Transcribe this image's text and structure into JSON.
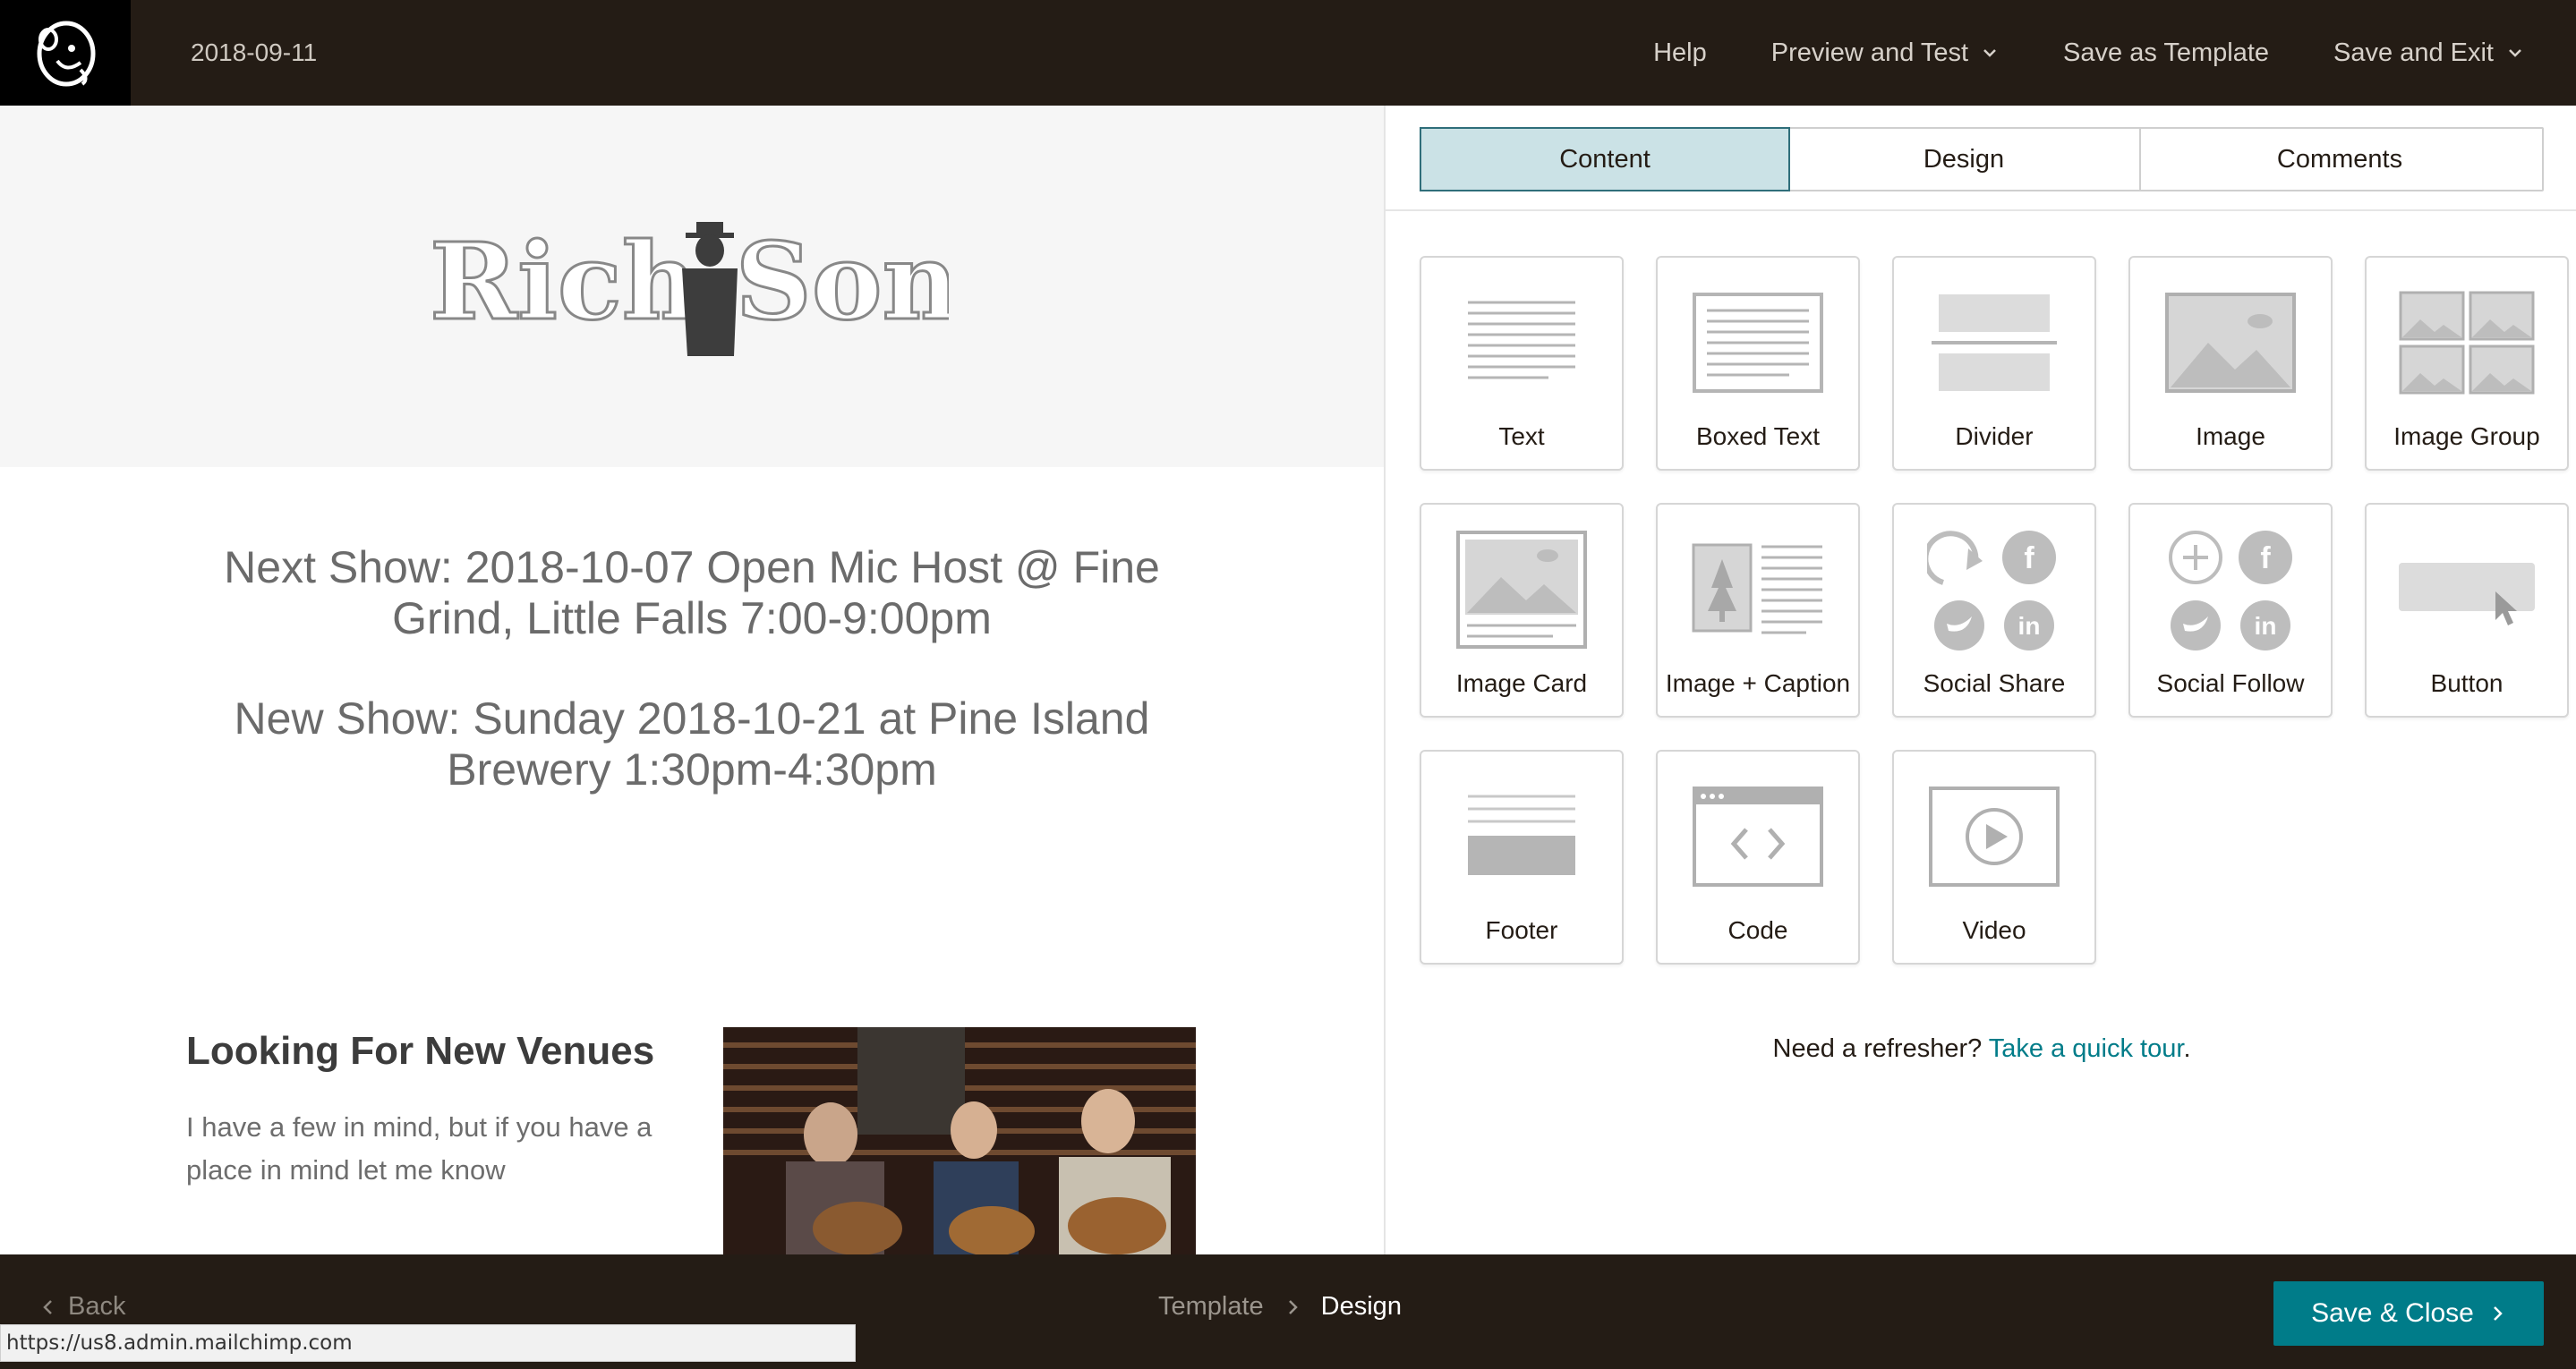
{
  "topbar": {
    "logo_icon": "mailchimp-logo-icon",
    "campaign_name": "2018-09-11",
    "nav": {
      "help": "Help",
      "preview_test": "Preview and Test",
      "save_template": "Save as Template",
      "save_exit": "Save and Exit"
    }
  },
  "preview": {
    "brand_logo_text": "Rich Soni",
    "show_line_1a": "Next Show: 2018-10-07 Open Mic Host @ Fine",
    "show_line_1b": "Grind, Little Falls 7:00-9:00pm",
    "show_line_2a": "New Show: Sunday 2018-10-21 at Pine Island",
    "show_line_2b": "Brewery 1:30pm-4:30pm",
    "venues_title": "Looking For New Venues",
    "venues_body": "I have a few in mind, but if you have a place in mind let me know"
  },
  "panel": {
    "tabs": [
      {
        "label": "Content",
        "active": true
      },
      {
        "label": "Design",
        "active": false
      },
      {
        "label": "Comments",
        "active": false
      }
    ],
    "blocks": [
      {
        "label": "Text",
        "icon": "text-block-icon"
      },
      {
        "label": "Boxed Text",
        "icon": "boxed-text-block-icon"
      },
      {
        "label": "Divider",
        "icon": "divider-block-icon"
      },
      {
        "label": "Image",
        "icon": "image-block-icon"
      },
      {
        "label": "Image Group",
        "icon": "image-group-block-icon"
      },
      {
        "label": "Image Card",
        "icon": "image-card-block-icon"
      },
      {
        "label": "Image + Caption",
        "icon": "image-caption-block-icon"
      },
      {
        "label": "Social Share",
        "icon": "social-share-block-icon"
      },
      {
        "label": "Social Follow",
        "icon": "social-follow-block-icon"
      },
      {
        "label": "Button",
        "icon": "button-block-icon"
      },
      {
        "label": "Footer",
        "icon": "footer-block-icon"
      },
      {
        "label": "Code",
        "icon": "code-block-icon"
      },
      {
        "label": "Video",
        "icon": "video-block-icon"
      }
    ],
    "refresher_text": "Need a refresher?",
    "refresher_link": "Take a quick tour",
    "refresher_end": "."
  },
  "bottombar": {
    "back_label": "Back",
    "crumb_template": "Template",
    "crumb_design": "Design",
    "save_close": "Save & Close",
    "status_url": "https://us8.admin.mailchimp.com"
  },
  "colors": {
    "topbar_bg": "#241c15",
    "accent_teal": "#007c89",
    "active_tab_bg": "#cbe2e6"
  }
}
